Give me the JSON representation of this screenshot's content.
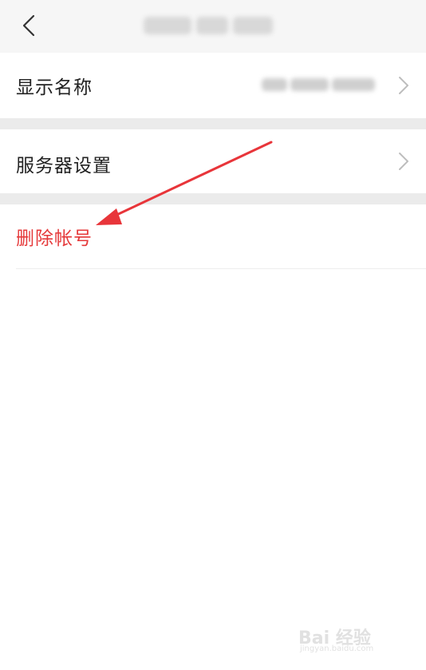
{
  "header": {
    "back_icon": "chevron-left-icon"
  },
  "settings": {
    "display_name_label": "显示名称",
    "server_settings_label": "服务器设置",
    "delete_account_label": "删除帐号",
    "delete_color": "#e5393a",
    "chevron_icon": "chevron-right-icon"
  },
  "annotation": {
    "arrow_color": "#e8353a"
  },
  "watermark": {
    "brand": "Bai 经验",
    "url": "jingyan.baidu.com"
  }
}
